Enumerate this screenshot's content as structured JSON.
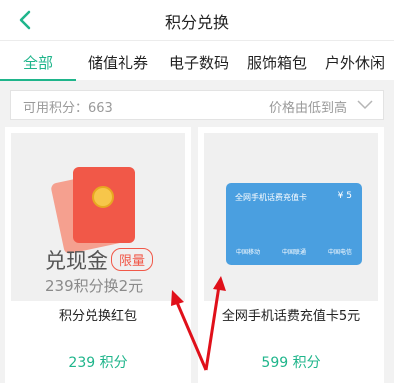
{
  "header": {
    "title": "积分兑换"
  },
  "tabs": [
    {
      "label": "全部"
    },
    {
      "label": "储值礼券"
    },
    {
      "label": "电子数码"
    },
    {
      "label": "服饰箱包"
    },
    {
      "label": "户外休闲"
    }
  ],
  "filter": {
    "points": "可用积分：663",
    "sort": "价格由低到高"
  },
  "products": [
    {
      "name": "积分兑换红包",
      "price": "239 积分",
      "image": {
        "cash": "兑现金",
        "badge": "限量",
        "rate": "239积分换2元"
      }
    },
    {
      "name": "全网手机话费充值卡5元",
      "price": "599 积分",
      "image": {
        "card_title": "全网手机话费充值卡",
        "card_amount": "¥ 5",
        "logos": [
          "中国移动",
          "中国联通",
          "中国电信"
        ]
      }
    }
  ],
  "colors": {
    "accent": "#1fb58b",
    "red": "#f15848",
    "annotation": "#e0101a",
    "card_blue": "#4a9fe0"
  },
  "icons": [
    "back-chevron-icon",
    "chevron-down-icon",
    "red-envelope-icon",
    "phone-card-icon"
  ]
}
